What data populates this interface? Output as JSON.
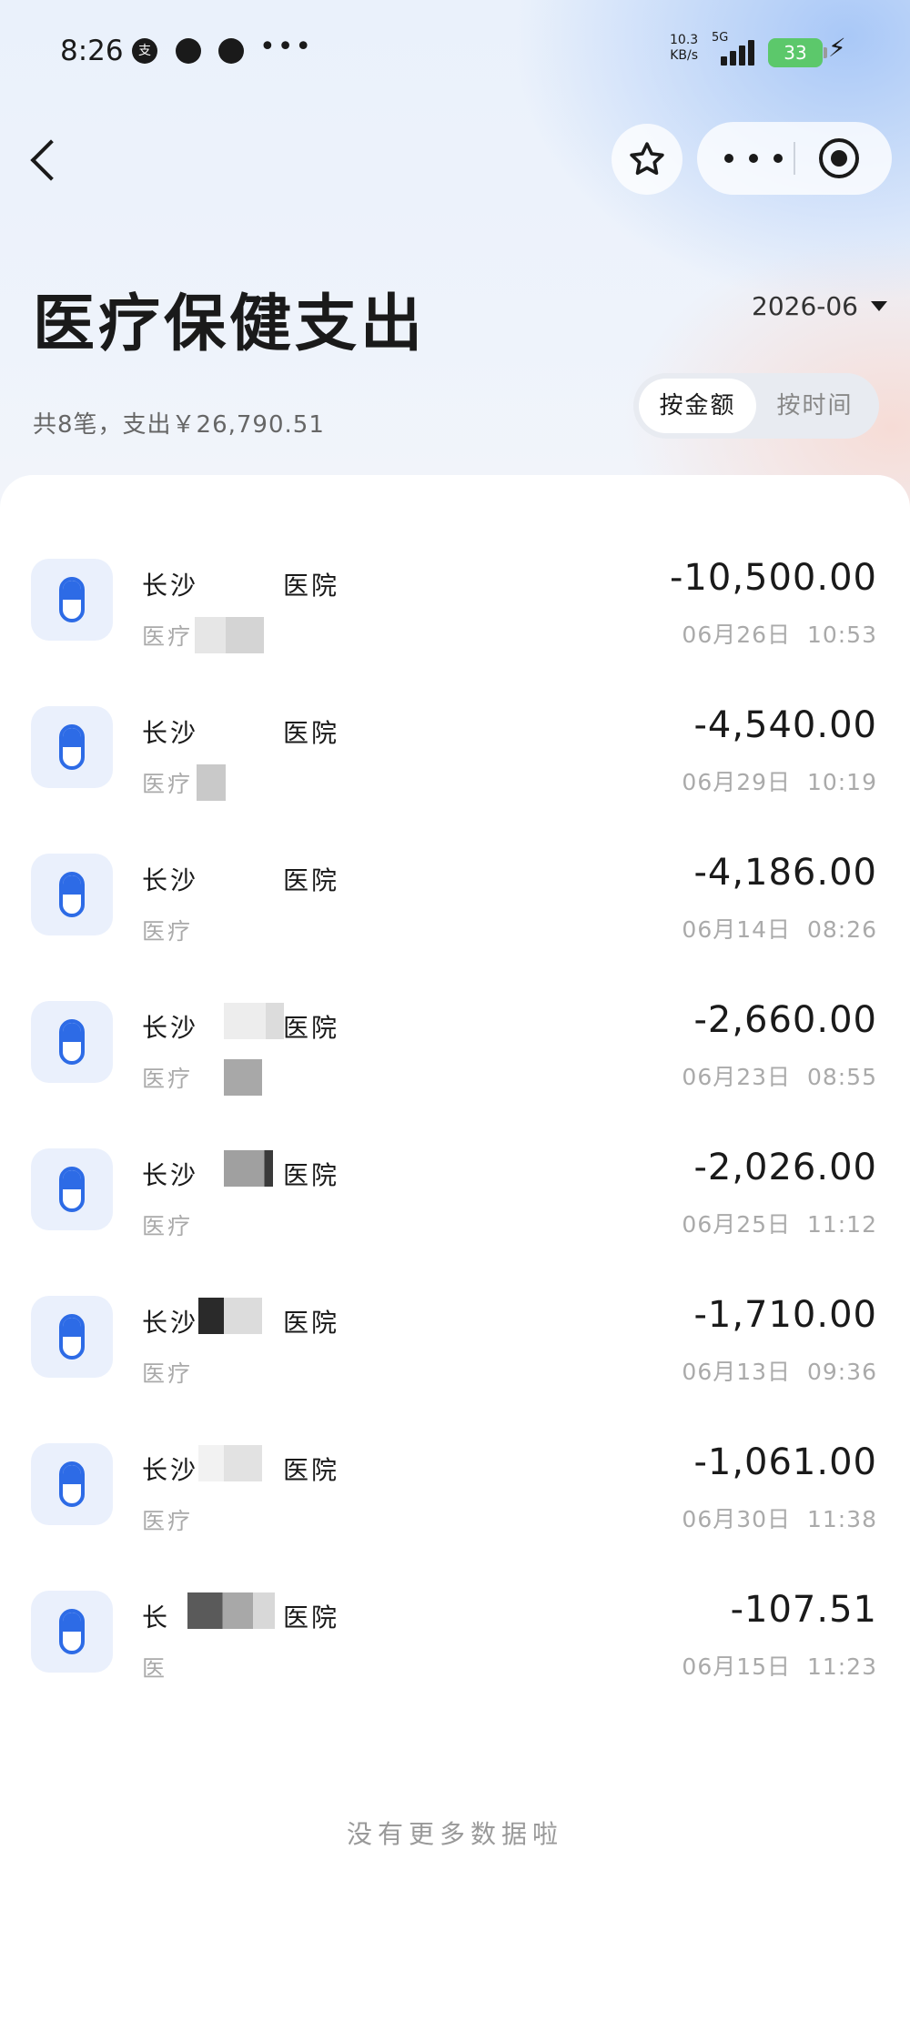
{
  "status_bar": {
    "time": "8:26",
    "app_icons": [
      "支",
      "●",
      "●"
    ],
    "more": "•••",
    "net_speed": "10.3",
    "net_unit": "KB/s",
    "network": "5G",
    "battery": "33"
  },
  "nav": {
    "back_icon": "chevron-left-icon",
    "favorite_icon": "star-icon",
    "more_icon": "more-icon",
    "close_icon": "target-icon"
  },
  "header": {
    "title": "医疗保健支出",
    "month": "2026-06",
    "summary": "共8笔，支出￥26,790.51",
    "sort_options": [
      "按金额",
      "按时间"
    ],
    "active_sort": "按金额"
  },
  "transactions": [
    {
      "name": "长沙　　　医院",
      "category": "医疗",
      "amount": "-10,500.00",
      "date": "06月26日  10:53"
    },
    {
      "name": "长沙　　　医院",
      "category": "医疗",
      "amount": "-4,540.00",
      "date": "06月29日  10:19"
    },
    {
      "name": "长沙　　　医院",
      "category": "医疗",
      "amount": "-4,186.00",
      "date": "06月14日  08:26"
    },
    {
      "name": "长沙　　　医院",
      "category": "医疗",
      "amount": "-2,660.00",
      "date": "06月23日  08:55"
    },
    {
      "name": "长沙　　　医院",
      "category": "医疗",
      "amount": "-2,026.00",
      "date": "06月25日  11:12"
    },
    {
      "name": "长沙　　　医院",
      "category": "医疗",
      "amount": "-1,710.00",
      "date": "06月13日  09:36"
    },
    {
      "name": "长沙　　　医院",
      "category": "医疗",
      "amount": "-1,061.00",
      "date": "06月30日  11:38"
    },
    {
      "name": "长　　　　医院",
      "category": "医",
      "amount": "-107.51",
      "date": "06月15日  11:23"
    }
  ],
  "footer": "没有更多数据啦",
  "colors": {
    "accent": "#2d6be6",
    "icon_bg": "#eaf0fc",
    "battery": "#5cc86b"
  }
}
